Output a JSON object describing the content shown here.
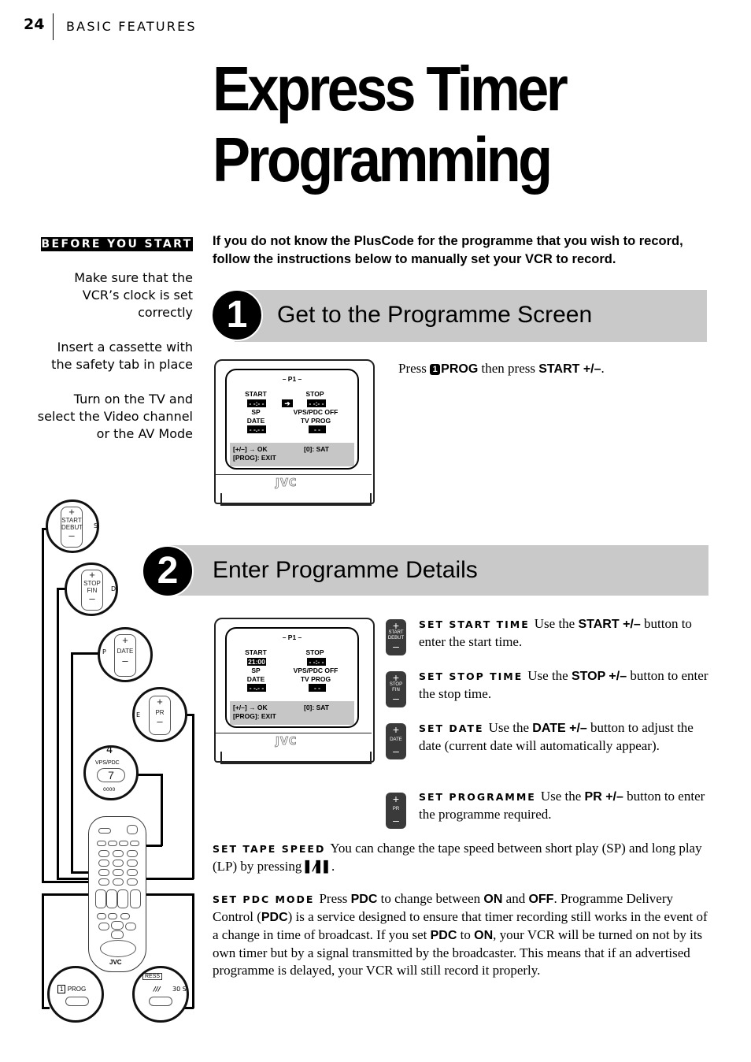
{
  "header": {
    "page_number": "24",
    "section": "BASIC FEATURES"
  },
  "title": {
    "line1": "Express Timer",
    "line2": "Programming"
  },
  "before_you_start": {
    "heading": "BEFORE YOU START",
    "items": [
      [
        "Make sure that the",
        "VCR’s clock is set",
        "correctly"
      ],
      [
        "Insert a cassette with",
        "the safety tab in place"
      ],
      [
        "Turn on the TV and",
        "select the Video channel",
        "or the AV Mode"
      ]
    ]
  },
  "intro": "If you do not know the PlusCode for the programme that you wish to record, follow the instructions below to manually set your VCR to record.",
  "step1": {
    "number": "1",
    "title": "Get to the Programme Screen",
    "instruction": {
      "press": "Press",
      "key_num": "1",
      "key_label": "PROG",
      "then": "then press",
      "button": "START +/–",
      "end": "."
    },
    "screen": {
      "header": "– P1 –",
      "start_label": "START",
      "start_value": "- -:- -",
      "arrow": "➔",
      "stop_label": "STOP",
      "stop_value": "- -:- -",
      "speed": "SP",
      "vps": "VPS/PDC OFF",
      "date_label": "DATE",
      "date_value": "- -.- -",
      "tvprog_label": "TV PROG",
      "tvprog_value": "- -",
      "footer_left1": "[+/–] → OK",
      "footer_left2": "[PROG]: EXIT",
      "footer_right": "[0]: SAT",
      "brand": "JVC"
    }
  },
  "step2": {
    "number": "2",
    "title": "Enter Programme Details",
    "screen": {
      "header": "– P1 –",
      "start_label": "START",
      "start_value": "21:00",
      "stop_label": "STOP",
      "stop_value": "- -:- -",
      "speed": "SP",
      "vps": "VPS/PDC OFF",
      "date_label": "DATE",
      "date_value": "- -.- -",
      "tvprog_label": "TV PROG",
      "tvprog_value": "- -",
      "footer_left1": "[+/–] → OK",
      "footer_left2": "[PROG]: EXIT",
      "footer_right": "[0]: SAT",
      "brand": "JVC"
    },
    "instructions": [
      {
        "icon_label1": "START",
        "icon_label2": "DEBUT",
        "keyword": "SET START TIME",
        "pre": "Use the",
        "button": "START +/–",
        "post": "button to enter the start time."
      },
      {
        "icon_label1": "STOP",
        "icon_label2": "FIN",
        "keyword": "SET STOP TIME",
        "pre": "Use the",
        "button": "STOP +/–",
        "post": "button to enter the stop time."
      },
      {
        "icon_label1": "DATE",
        "icon_label2": "",
        "keyword": "SET DATE",
        "pre": "Use the",
        "button": "DATE +/–",
        "post": "button to adjust the date (current date will automatically appear)."
      },
      {
        "icon_label1": "PR",
        "icon_label2": "",
        "keyword": "SET PROGRAMME",
        "pre": "Use the",
        "button": "PR +/–",
        "post": "button to enter the programme required."
      }
    ],
    "tape_speed": {
      "keyword": "SET TAPE SPEED",
      "text": "You can change the tape speed between short play (SP) and long play (LP) by pressing",
      "symbol": "▰/▰▰",
      "end": "."
    },
    "pdc_mode": {
      "keyword": "SET PDC MODE",
      "t1": "Press",
      "b1": "PDC",
      "t2": "to change between",
      "b2": "ON",
      "t3": "and",
      "b3": "OFF",
      "t4": ". Programme Delivery Control (",
      "b4": "PDC",
      "t5": ") is a service designed to ensure that timer recording still works in the event of a change in time of broadcast. If you set",
      "b5": "PDC",
      "t6": "to",
      "b6": "ON",
      "t7": ", your VCR will be turned on not by its own timer but by a signal transmitted by the broadcaster. This means that if an advertised programme is delayed, your VCR will still record it properly."
    }
  },
  "remote_callouts": {
    "start": {
      "plus": "+",
      "l1": "START",
      "l2": "DEBUT",
      "minus": "–",
      "side": "S"
    },
    "stop": {
      "plus": "+",
      "l1": "STOP",
      "l2": "FIN",
      "minus": "–",
      "side": "D"
    },
    "date": {
      "plus": "+",
      "l1": "DATE",
      "minus": "–",
      "side": "P"
    },
    "pr": {
      "plus": "+",
      "l1": "PR",
      "minus": "–",
      "side": "E"
    },
    "vps": {
      "top": "4",
      "label": "VPS/PDC",
      "key": "7",
      "bottom": "0000"
    },
    "prog": {
      "num": "1",
      "label": "PROG"
    },
    "speed": {
      "top": "RESS",
      "label": "▰▰▰",
      "side": "30 S"
    },
    "brand": "JVC"
  }
}
